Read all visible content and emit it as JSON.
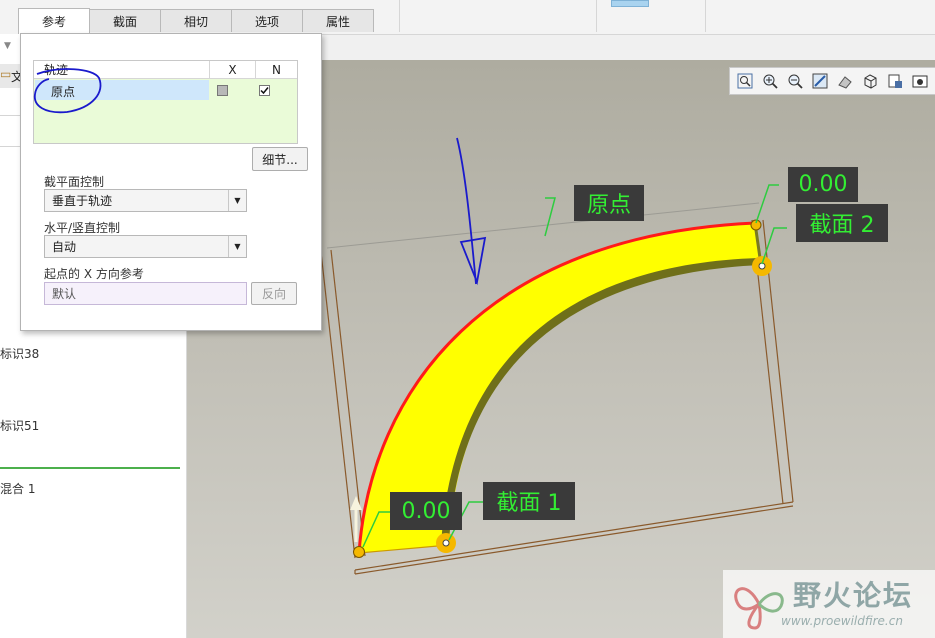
{
  "tabs": [
    {
      "label": "参考",
      "active": true
    },
    {
      "label": "截面"
    },
    {
      "label": "相切"
    },
    {
      "label": "选项"
    },
    {
      "label": "属性"
    }
  ],
  "left_panel": {
    "tab_fragment": "文",
    "items": [
      "标识38",
      "标识51",
      "混合 1"
    ]
  },
  "popup": {
    "table": {
      "col_trajectory": "轨迹",
      "col_x": "X",
      "col_n": "N",
      "row": {
        "name": "原点",
        "x_checked": false,
        "n_checked": true
      }
    },
    "details_button": "细节...",
    "section_plane_label": "截平面控制",
    "section_plane_value": "垂直于轨迹",
    "hv_label": "水平/竖直控制",
    "hv_value": "自动",
    "xref_label": "起点的 X 方向参考",
    "xref_value": "默认",
    "reverse_button": "反向"
  },
  "viewport": {
    "tag_origin": "原点",
    "tag_dim_top": "0.00",
    "tag_section2": "截面 2",
    "tag_dim_bottom": "0.00",
    "tag_section1": "截面 1"
  },
  "watermark": {
    "title": "野火论坛",
    "url": "www.proewildfire.cn"
  },
  "colors": {
    "sweep_fill": "#ffff00",
    "trajectory": "#ff1a1a",
    "tag_text": "#33ee33",
    "annotation": "#1a1acc"
  },
  "icons": [
    "zoom-fit-icon",
    "zoom-in-icon",
    "zoom-out-icon",
    "repaint-icon",
    "display-style-icon",
    "saved-view-icon",
    "layer-icon",
    "screenshot-icon"
  ]
}
